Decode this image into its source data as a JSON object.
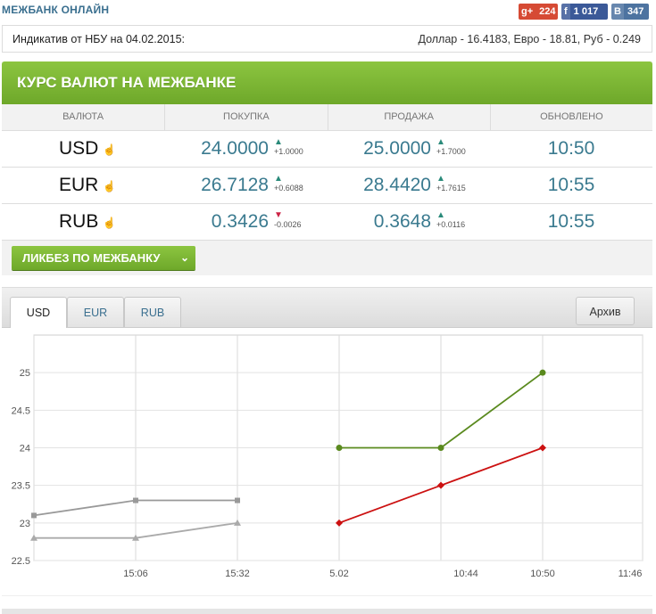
{
  "site": {
    "title": "МЕЖБАНК ОНЛАЙН"
  },
  "social": {
    "gplus": {
      "icon_label": "g+",
      "count": "224"
    },
    "facebook": {
      "icon_label": "f",
      "count": "1 017"
    },
    "vk": {
      "icon_label": "B",
      "count": "347"
    }
  },
  "nbu": {
    "label": "Индикатив от НБУ на 04.02.2015:",
    "rates": "Доллар - 16.4183, Евро - 18.81, Руб - 0.249"
  },
  "panel": {
    "title": "КУРС ВАЛЮТ НА МЕЖБАНКЕ",
    "headers": [
      "ВАЛЮТА",
      "ПОКУПКА",
      "ПРОДАЖА",
      "ОБНОВЛЕНО"
    ],
    "rows": [
      {
        "currency": "USD",
        "buy": "24.0000",
        "buy_change": "+1.0000",
        "buy_dir": "up",
        "sell": "25.0000",
        "sell_change": "+1.7000",
        "sell_dir": "up",
        "updated": "10:50"
      },
      {
        "currency": "EUR",
        "buy": "26.7128",
        "buy_change": "+0.6088",
        "buy_dir": "up",
        "sell": "28.4420",
        "sell_change": "+1.7615",
        "sell_dir": "up",
        "updated": "10:55"
      },
      {
        "currency": "RUB",
        "buy": "0.3426",
        "buy_change": "-0.0026",
        "buy_dir": "down",
        "sell": "0.3648",
        "sell_change": "+0.0116",
        "sell_dir": "up",
        "updated": "10:55"
      }
    ],
    "likbez_label": "ЛИКБЕЗ ПО МЕЖБАНКУ"
  },
  "chart_tabs": {
    "usd": "USD",
    "eur": "EUR",
    "rub": "RUB",
    "archive": "Архив"
  },
  "chart_data": {
    "type": "line",
    "x": [
      "",
      "15:06",
      "15:32",
      "5.02",
      "",
      "10:44",
      "10:50",
      "11:46"
    ],
    "y_ticks": [
      "22.5",
      "23",
      "23.5",
      "24",
      "24.5",
      "25"
    ],
    "ylim": [
      22.5,
      25.5
    ],
    "grid": true,
    "colors": {
      "sell_today": "#5a8a1e",
      "buy_today": "#cc1111",
      "sell_prev": "#999999",
      "buy_prev": "#aaaaaa"
    },
    "series": [
      {
        "points": [
          [
            0,
            23.1
          ],
          [
            1,
            23.3
          ],
          [
            2,
            23.3
          ]
        ],
        "color": "#999999",
        "marker": "square"
      },
      {
        "points": [
          [
            0,
            22.8
          ],
          [
            1,
            22.8
          ],
          [
            2,
            23.0
          ]
        ],
        "color": "#aaaaaa",
        "marker": "triangle"
      },
      {
        "points": [
          [
            3,
            24.0
          ],
          [
            4,
            24.0
          ],
          [
            5,
            25.0
          ]
        ],
        "color": "#5a8a1e",
        "marker": "circle"
      },
      {
        "points": [
          [
            3,
            23.0
          ],
          [
            4,
            23.5
          ],
          [
            5,
            24.0
          ]
        ],
        "color": "#cc1111",
        "marker": "diamond"
      }
    ]
  }
}
